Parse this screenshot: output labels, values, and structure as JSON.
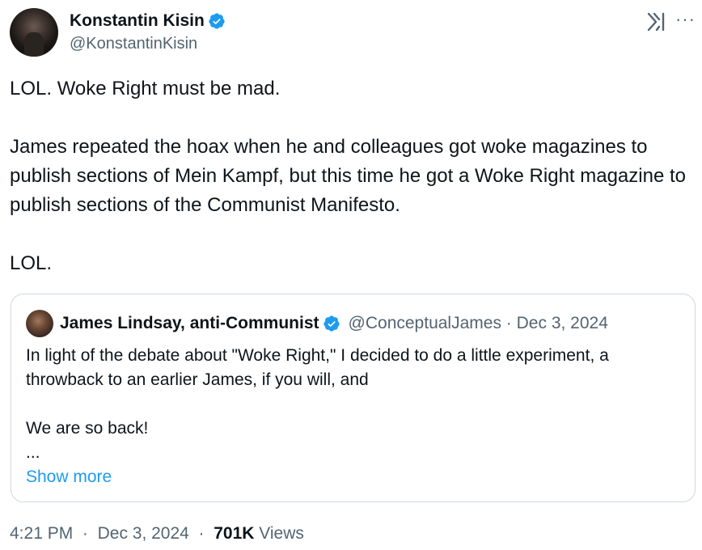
{
  "author": {
    "display_name": "Konstantin Kisin",
    "handle": "@KonstantinKisin",
    "verified": true,
    "avatar": "person-avatar"
  },
  "icons": {
    "verified": "verified-badge-icon",
    "grok": "grok-icon",
    "more": "more-options-icon"
  },
  "colors": {
    "verified": "#1d9bf0",
    "link": "#1d9bf0",
    "text": "#0f1419",
    "secondary_text": "#536471",
    "border": "#cfd9de"
  },
  "post": {
    "paragraphs": [
      "LOL. Woke Right must be mad.",
      "James repeated the hoax when he and colleagues got woke magazines to publish sections of Mein Kampf, but this time he got a Woke Right magazine to publish sections of the Communist Manifesto.",
      "LOL."
    ]
  },
  "quoted": {
    "display_name": "James Lindsay, anti-Communist",
    "handle": "@ConceptualJames",
    "separator": "·",
    "date": "Dec 3, 2024",
    "verified": true,
    "paragraphs": [
      "In light of the debate about \"Woke Right,\" I decided to do a little experiment, a throwback to an earlier James, if you will, and",
      "We are so back!",
      "..."
    ],
    "show_more_label": "Show more"
  },
  "footer": {
    "time": "4:21 PM",
    "separator": "·",
    "date": "Dec 3, 2024",
    "views_count": "701K",
    "views_label": "Views"
  }
}
